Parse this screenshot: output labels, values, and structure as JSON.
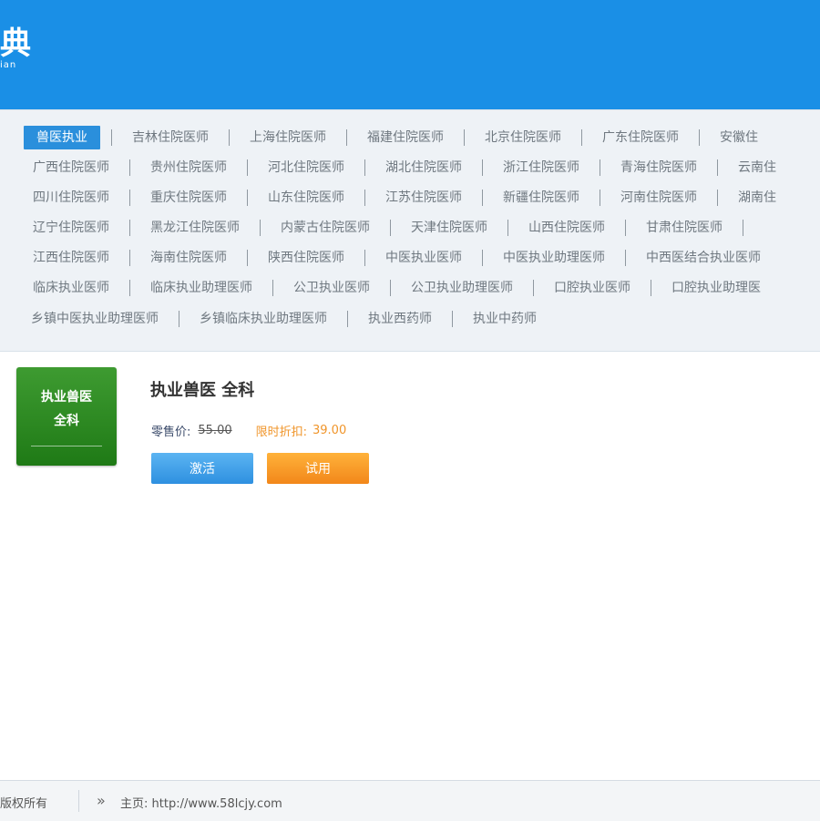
{
  "header": {
    "logo_char": "典",
    "logo_sub": "ian"
  },
  "categories": [
    [
      "兽医执业",
      "吉林住院医师",
      "上海住院医师",
      "福建住院医师",
      "北京住院医师",
      "广东住院医师",
      "安徽住"
    ],
    [
      "广西住院医师",
      "贵州住院医师",
      "河北住院医师",
      "湖北住院医师",
      "浙江住院医师",
      "青海住院医师",
      "云南住"
    ],
    [
      "四川住院医师",
      "重庆住院医师",
      "山东住院医师",
      "江苏住院医师",
      "新疆住院医师",
      "河南住院医师",
      "湖南住"
    ],
    [
      "辽宁住院医师",
      "黑龙江住院医师",
      "内蒙古住院医师",
      "天津住院医师",
      "山西住院医师",
      "甘肃住院医师"
    ],
    [
      "江西住院医师",
      "海南住院医师",
      "陕西住院医师",
      "中医执业医师",
      "中医执业助理医师",
      "中西医结合执业医师"
    ],
    [
      "临床执业医师",
      "临床执业助理医师",
      "公卫执业医师",
      "公卫执业助理医师",
      "口腔执业医师",
      "口腔执业助理医"
    ],
    [
      "乡镇中医执业助理医师",
      "乡镇临床执业助理医师",
      "执业西药师",
      "执业中药师"
    ]
  ],
  "active_category": "兽医执业",
  "product": {
    "cover_line1": "执业兽医",
    "cover_line2": "全科",
    "title": "执业兽医  全科",
    "retail_label": "零售价:",
    "retail_price": "55.00",
    "sale_label": "限时折扣:",
    "sale_price": "39.00",
    "activate_label": "激活",
    "trial_label": "试用"
  },
  "status": {
    "copyright": "版权所有",
    "home": "主页: http://www.58lcjy.com"
  },
  "colors": {
    "header": "#1a8fe6",
    "active_tab": "#2a8fdc",
    "cover_green": "#2a8a20",
    "activate_button": "#2e90e0",
    "trial_button": "#f2871a",
    "sale_text": "#f0952a"
  }
}
